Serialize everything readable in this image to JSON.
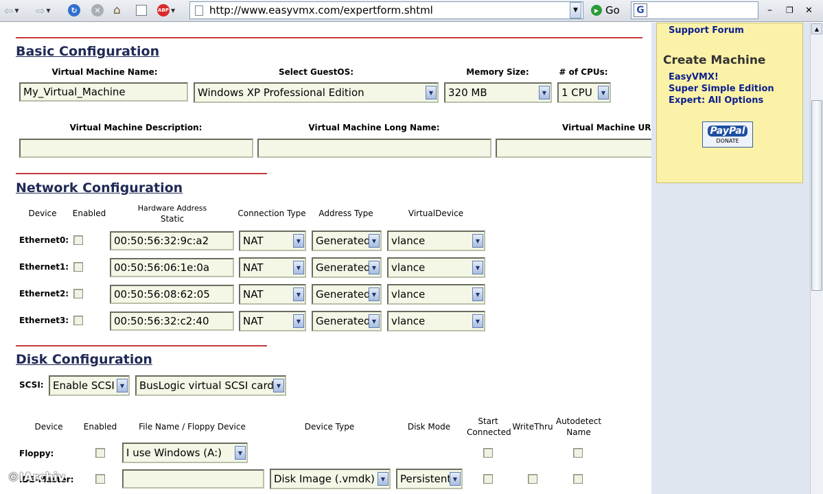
{
  "toolbar": {
    "url": "http://www.easyvmx.com/expertform.shtml",
    "go_label": "Go",
    "icons": [
      "back-arrow-icon",
      "forward-arrow-icon",
      "refresh-icon",
      "stop-icon",
      "home-icon",
      "history-icon",
      "adblock-icon",
      "page-icon",
      "go-icon",
      "google-icon"
    ],
    "adblock_label": "ABP"
  },
  "basic": {
    "title": "Basic Configuration",
    "vm_name_label": "Virtual Machine Name:",
    "vm_name_value": "My_Virtual_Machine",
    "guest_os_label": "Select GuestOS:",
    "guest_os_value": "Windows XP Professional Edition",
    "memory_label": "Memory Size:",
    "memory_value": "320 MB",
    "cpus_label": "# of CPUs:",
    "cpus_value": "1 CPU",
    "description_label": "Virtual Machine Description:",
    "long_name_label": "Virtual Machine Long Name:",
    "url_label": "Virtual Machine URL"
  },
  "network": {
    "title": "Network Configuration",
    "headers": {
      "device": "Device",
      "enabled": "Enabled",
      "hw_address_1": "Hardware Address",
      "hw_address_2": "Static",
      "connection_type": "Connection Type",
      "address_type": "Address Type",
      "virtual_device": "VirtualDevice"
    },
    "rows": [
      {
        "device": "Ethernet0:",
        "mac": "00:50:56:32:9c:a2",
        "connection": "NAT",
        "address": "Generated",
        "virtual": "vlance"
      },
      {
        "device": "Ethernet1:",
        "mac": "00:50:56:06:1e:0a",
        "connection": "NAT",
        "address": "Generated",
        "virtual": "vlance"
      },
      {
        "device": "Ethernet2:",
        "mac": "00:50:56:08:62:05",
        "connection": "NAT",
        "address": "Generated",
        "virtual": "vlance"
      },
      {
        "device": "Ethernet3:",
        "mac": "00:50:56:32:c2:40",
        "connection": "NAT",
        "address": "Generated",
        "virtual": "vlance"
      }
    ]
  },
  "disk": {
    "title": "Disk Configuration",
    "scsi_label": "SCSI:",
    "scsi_value": "Enable SCSI",
    "scsi_adapter_value": "BusLogic virtual SCSI card",
    "headers": {
      "device": "Device",
      "enabled": "Enabled",
      "file_name": "File Name / Floppy Device",
      "device_type": "Device Type",
      "disk_mode": "Disk Mode",
      "start_connected_1": "Start",
      "start_connected_2": "Connected",
      "write_thru": "WriteThru",
      "autodetect_1": "Autodetect",
      "autodetect_2": "Name"
    },
    "floppy": {
      "device": "Floppy:",
      "file": "I use Windows (A:)"
    },
    "ide": {
      "device": "IDE-Master:",
      "file": "",
      "device_type": "Disk Image (.vmdk)",
      "disk_mode": "Persistent"
    }
  },
  "sidebar": {
    "support_forum": "Support Forum",
    "create_machine_title": "Create Machine",
    "links": [
      "EasyVMX!",
      "Super Simple Edition",
      "Expert: All Options"
    ],
    "paypal_label": "PayPal",
    "paypal_donate": "DONATE"
  },
  "watermark": "©IArchiv"
}
